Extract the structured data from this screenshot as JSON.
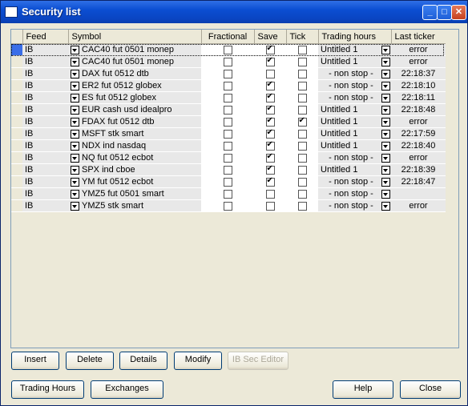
{
  "window": {
    "title": "Security list"
  },
  "columns": [
    "Feed",
    "Symbol",
    "Fractional",
    "Save",
    "Tick",
    "Trading hours",
    "Last ticker"
  ],
  "rows": [
    {
      "feed": "IB",
      "symbol": "CAC40 fut 0501 monep",
      "fractional": false,
      "save": true,
      "tick": false,
      "hours": "Untitled 1",
      "last": "error",
      "selected": true
    },
    {
      "feed": "IB",
      "symbol": "CAC40 fut 0501 monep",
      "fractional": false,
      "save": true,
      "tick": false,
      "hours": "Untitled 1",
      "last": "error"
    },
    {
      "feed": "IB",
      "symbol": "DAX fut 0512 dtb",
      "fractional": false,
      "save": false,
      "tick": false,
      "hours": "- non stop -",
      "last": "22:18:37"
    },
    {
      "feed": "IB",
      "symbol": "ER2 fut 0512 globex",
      "fractional": false,
      "save": true,
      "tick": false,
      "hours": "- non stop -",
      "last": "22:18:10"
    },
    {
      "feed": "IB",
      "symbol": "ES fut 0512 globex",
      "fractional": false,
      "save": true,
      "tick": false,
      "hours": "- non stop -",
      "last": "22:18:11"
    },
    {
      "feed": "IB",
      "symbol": "EUR cash usd  idealpro",
      "fractional": false,
      "save": true,
      "tick": false,
      "hours": "Untitled 1",
      "last": "22:18:48"
    },
    {
      "feed": "IB",
      "symbol": "FDAX fut 0512 dtb",
      "fractional": false,
      "save": true,
      "tick": true,
      "hours": "Untitled 1",
      "last": "error"
    },
    {
      "feed": "IB",
      "symbol": "MSFT stk smart",
      "fractional": false,
      "save": true,
      "tick": false,
      "hours": "Untitled 1",
      "last": "22:17:59"
    },
    {
      "feed": "IB",
      "symbol": "NDX ind nasdaq",
      "fractional": false,
      "save": true,
      "tick": false,
      "hours": "Untitled 1",
      "last": "22:18:40"
    },
    {
      "feed": "IB",
      "symbol": "NQ fut 0512 ecbot",
      "fractional": false,
      "save": true,
      "tick": false,
      "hours": "- non stop -",
      "last": "error"
    },
    {
      "feed": "IB",
      "symbol": "SPX ind cboe",
      "fractional": false,
      "save": true,
      "tick": false,
      "hours": "Untitled 1",
      "last": "22:18:39"
    },
    {
      "feed": "IB",
      "symbol": "YM fut 0512 ecbot",
      "fractional": false,
      "save": true,
      "tick": false,
      "hours": "- non stop -",
      "last": "22:18:47"
    },
    {
      "feed": "IB",
      "symbol": "YMZ5 fut 0501 smart",
      "fractional": false,
      "save": false,
      "tick": false,
      "hours": "- non stop -",
      "last": ""
    },
    {
      "feed": "IB",
      "symbol": "YMZ5 stk smart",
      "fractional": false,
      "save": false,
      "tick": false,
      "hours": "- non stop -",
      "last": "error"
    }
  ],
  "buttons": {
    "insert": "Insert",
    "delete": "Delete",
    "details": "Details",
    "modify": "Modify",
    "ib_sec_editor": "IB Sec Editor",
    "trading_hours": "Trading Hours",
    "exchanges": "Exchanges",
    "help": "Help",
    "close": "Close"
  },
  "colors": {
    "title_bar": "#0b4ed2",
    "selection": "#3a6ee8",
    "window_bg": "#ece9d8"
  }
}
